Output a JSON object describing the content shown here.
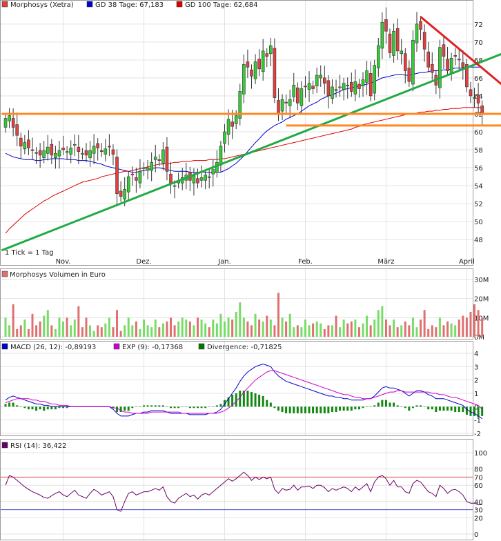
{
  "chart_data": [
    {
      "type": "candlestick",
      "legend": [
        {
          "label": "Morphosys (Xetra)",
          "color": "#d94040"
        },
        {
          "label": "GD 38 Tage: 67,183",
          "color": "#0000cc"
        },
        {
          "label": "GD 100 Tage: 62,684",
          "color": "#dd0000"
        }
      ],
      "y_ticks": [
        "72",
        "70",
        "68",
        "66",
        "64",
        "62",
        "60",
        "58",
        "56",
        "54",
        "52",
        "50",
        "48"
      ],
      "ylim": [
        46.4,
        73.6
      ],
      "x_ticks": [
        "Nov.",
        "Dez.",
        "Jan.",
        "Feb.",
        "März",
        "April"
      ],
      "x_tick_index": [
        15,
        36,
        57,
        78,
        99,
        120
      ],
      "tick_note": "1 Tick = 1 Tag",
      "closes": [
        61.5,
        61.8,
        60.5,
        59.6,
        58.4,
        58.8,
        58.2,
        58.0,
        57.6,
        57.4,
        57.9,
        58.3,
        57.4,
        57.6,
        57.9,
        58.0,
        57.8,
        58.2,
        58.6,
        57.8,
        57.6,
        57.4,
        57.9,
        58.4,
        58.2,
        57.8,
        58.1,
        58.3,
        57.5,
        53.1,
        52.8,
        53.6,
        55.0,
        55.2,
        54.6,
        55.6,
        56.0,
        56.0,
        56.6,
        57.2,
        56.8,
        58.0,
        55.6,
        54.3,
        54.0,
        54.6,
        54.9,
        55.2,
        54.6,
        55.1,
        54.3,
        54.9,
        55.2,
        55.0,
        55.8,
        56.6,
        58.4,
        60.0,
        61.4,
        60.6,
        61.8,
        64.5,
        67.5,
        67.2,
        66.2,
        67.8,
        67.0,
        69.0,
        68.4,
        69.6,
        63.8,
        62.0,
        63.6,
        63.2,
        63.6,
        65.2,
        63.2,
        64.8,
        65.0,
        65.4,
        64.8,
        66.3,
        66.3,
        65.4,
        64.0,
        65.0,
        64.6,
        65.0,
        65.4,
        65.2,
        64.5,
        65.6,
        64.8,
        65.8,
        66.8,
        64.0,
        67.4,
        69.6,
        72.2,
        71.2,
        68.8,
        71.2,
        69.0,
        69.0,
        66.8,
        65.6,
        70.2,
        72.0,
        71.4,
        69.2,
        67.2,
        66.6,
        65.2,
        69.4,
        68.4,
        66.8,
        68.2,
        68.4,
        68.0,
        67.2,
        65.0,
        64.0,
        63.8,
        63.2,
        62.0
      ],
      "gd38": [
        57.6,
        57.4,
        57.2,
        57.1,
        57.0,
        56.9,
        56.9,
        56.9,
        56.8,
        56.8,
        56.9,
        56.9,
        57.0,
        57.0,
        57.0,
        57.0,
        56.9,
        56.9,
        56.9,
        56.8,
        56.8,
        56.8,
        56.7,
        56.6,
        56.5,
        56.4,
        56.2,
        56.1,
        56.0,
        55.9,
        55.8,
        55.7,
        55.6,
        55.5,
        55.5,
        55.6,
        55.7,
        55.8,
        55.9,
        56.0,
        56.0,
        55.9,
        55.8,
        55.7,
        55.6,
        55.6,
        55.6,
        55.6,
        55.5,
        55.5,
        55.5,
        55.5,
        55.5,
        55.5,
        55.5,
        55.5,
        55.5,
        55.7,
        55.9,
        56.2,
        56.5,
        56.9,
        57.3,
        57.8,
        58.3,
        58.8,
        59.2,
        59.7,
        60.1,
        60.4,
        60.7,
        60.9,
        61.1,
        61.4,
        61.6,
        61.8,
        62.0,
        62.3,
        62.6,
        62.9,
        63.1,
        63.3,
        63.6,
        63.8,
        64.0,
        64.1,
        64.3,
        64.5,
        64.7,
        64.8,
        64.9,
        65.0,
        65.1,
        65.2,
        65.3,
        65.4,
        65.6,
        65.8,
        66.0,
        66.1,
        66.2,
        66.3,
        66.4,
        66.4,
        66.3,
        66.3,
        66.4,
        66.5,
        66.6,
        66.6,
        66.7,
        66.8,
        66.8,
        66.8,
        66.9,
        66.9,
        67.0,
        67.1,
        67.1,
        67.1,
        67.2,
        67.2,
        67.2,
        67.2,
        67.2
      ],
      "gd100": [
        48.7,
        49.2,
        49.6,
        50.0,
        50.4,
        50.8,
        51.1,
        51.4,
        51.7,
        52.0,
        52.3,
        52.5,
        52.8,
        53.0,
        53.2,
        53.4,
        53.6,
        53.8,
        54.0,
        54.2,
        54.4,
        54.5,
        54.6,
        54.7,
        54.8,
        55.0,
        55.1,
        55.2,
        55.3,
        55.4,
        55.5,
        55.6,
        55.6,
        55.7,
        55.8,
        55.9,
        56.0,
        56.1,
        56.2,
        56.3,
        56.4,
        56.4,
        56.5,
        56.5,
        56.6,
        56.6,
        56.7,
        56.7,
        56.7,
        56.8,
        56.8,
        56.8,
        56.8,
        56.9,
        56.9,
        56.9,
        57.0,
        57.0,
        57.1,
        57.2,
        57.3,
        57.4,
        57.5,
        57.6,
        57.7,
        57.8,
        57.9,
        58.0,
        58.1,
        58.2,
        58.3,
        58.4,
        58.5,
        58.6,
        58.7,
        58.8,
        58.9,
        59.0,
        59.1,
        59.2,
        59.3,
        59.4,
        59.5,
        59.6,
        59.7,
        59.8,
        59.9,
        60.0,
        60.1,
        60.2,
        60.3,
        60.5,
        60.6,
        60.8,
        60.9,
        61.0,
        61.1,
        61.2,
        61.3,
        61.4,
        61.5,
        61.6,
        61.7,
        61.8,
        61.9,
        62.0,
        62.0,
        62.1,
        62.2,
        62.2,
        62.3,
        62.3,
        62.4,
        62.4,
        62.5,
        62.5,
        62.6,
        62.6,
        62.6,
        62.7,
        62.7,
        62.7,
        62.7,
        62.7,
        62.7
      ]
    },
    {
      "type": "bar",
      "title": "Morphosys Volumen in Euro",
      "y_ticks": [
        "30M",
        "20M",
        "10M",
        "0M"
      ],
      "ylim": [
        0,
        30
      ],
      "values": [
        10,
        6,
        17,
        4,
        6,
        9,
        4,
        12,
        6,
        8,
        11,
        14,
        6,
        4,
        10,
        8,
        10,
        6,
        9,
        16,
        5,
        10,
        6,
        3,
        6,
        5,
        7,
        10,
        5,
        14,
        3,
        6,
        10,
        6,
        8,
        4,
        9,
        6,
        5,
        9,
        5,
        7,
        8,
        10,
        6,
        8,
        10,
        9,
        8,
        6,
        10,
        9,
        7,
        5,
        9,
        7,
        12,
        8,
        10,
        9,
        13,
        18,
        10,
        8,
        6,
        12,
        9,
        8,
        11,
        9,
        6,
        23,
        10,
        8,
        12,
        5,
        6,
        5,
        9,
        6,
        7,
        8,
        7,
        4,
        6,
        6,
        11,
        5,
        9,
        7,
        8,
        9,
        5,
        7,
        11,
        6,
        9,
        14,
        16,
        9,
        6,
        9,
        5,
        6,
        8,
        6,
        10,
        5,
        9,
        14,
        4,
        6,
        5,
        10,
        6,
        8,
        7,
        6,
        9,
        11,
        10,
        13,
        17,
        14,
        10
      ]
    },
    {
      "type": "line",
      "legend": [
        {
          "label": "MACD (26, 12): -0,89193",
          "color": "#0000cc"
        },
        {
          "label": "EXP (9): -0,17368",
          "color": "#cc00cc"
        },
        {
          "label": "Divergence: -0,71825",
          "color": "#007700"
        }
      ],
      "y_ticks": [
        "4",
        "3",
        "2",
        "1",
        "0",
        "-1",
        "-2"
      ],
      "ylim": [
        -2,
        4
      ],
      "macd": [
        0.5,
        0.7,
        0.8,
        0.7,
        0.6,
        0.5,
        0.4,
        0.3,
        0.2,
        0.2,
        0.1,
        0.1,
        0.0,
        0.0,
        0.0,
        0.0,
        0.0,
        0.0,
        0.0,
        0.0,
        0.0,
        0.0,
        0.0,
        0.0,
        0.0,
        0.0,
        0.0,
        0.0,
        -0.2,
        -0.5,
        -0.7,
        -0.7,
        -0.7,
        -0.6,
        -0.5,
        -0.5,
        -0.4,
        -0.4,
        -0.3,
        -0.3,
        -0.3,
        -0.3,
        -0.4,
        -0.5,
        -0.5,
        -0.5,
        -0.5,
        -0.5,
        -0.6,
        -0.6,
        -0.6,
        -0.6,
        -0.6,
        -0.5,
        -0.5,
        -0.4,
        -0.2,
        0.2,
        0.6,
        1.0,
        1.4,
        1.9,
        2.3,
        2.6,
        2.8,
        3.0,
        3.1,
        3.2,
        3.1,
        3.0,
        2.6,
        2.3,
        2.1,
        1.9,
        1.8,
        1.7,
        1.6,
        1.5,
        1.4,
        1.3,
        1.2,
        1.1,
        1.0,
        0.9,
        0.8,
        0.8,
        0.7,
        0.7,
        0.6,
        0.6,
        0.5,
        0.5,
        0.5,
        0.5,
        0.6,
        0.6,
        0.8,
        1.1,
        1.4,
        1.5,
        1.4,
        1.4,
        1.3,
        1.2,
        1.0,
        0.8,
        1.0,
        1.2,
        1.2,
        1.1,
        0.9,
        0.8,
        0.6,
        0.6,
        0.6,
        0.5,
        0.4,
        0.3,
        0.2,
        0.1,
        -0.2,
        -0.4,
        -0.5,
        -0.7,
        -0.9
      ],
      "exp": [
        0.3,
        0.4,
        0.5,
        0.6,
        0.6,
        0.6,
        0.6,
        0.5,
        0.5,
        0.4,
        0.4,
        0.3,
        0.2,
        0.2,
        0.1,
        0.1,
        0.1,
        0.0,
        0.0,
        0.0,
        0.0,
        0.0,
        0.0,
        0.0,
        0.0,
        0.0,
        0.0,
        0.0,
        -0.1,
        -0.1,
        -0.3,
        -0.4,
        -0.4,
        -0.5,
        -0.5,
        -0.5,
        -0.5,
        -0.5,
        -0.4,
        -0.4,
        -0.4,
        -0.4,
        -0.4,
        -0.4,
        -0.4,
        -0.4,
        -0.5,
        -0.5,
        -0.5,
        -0.5,
        -0.5,
        -0.5,
        -0.5,
        -0.5,
        -0.5,
        -0.5,
        -0.4,
        -0.3,
        -0.1,
        0.1,
        0.4,
        0.7,
        1.1,
        1.4,
        1.7,
        2.0,
        2.2,
        2.4,
        2.6,
        2.7,
        2.7,
        2.6,
        2.5,
        2.4,
        2.3,
        2.2,
        2.1,
        2.0,
        1.9,
        1.8,
        1.7,
        1.6,
        1.5,
        1.4,
        1.3,
        1.2,
        1.1,
        1.0,
        0.9,
        0.9,
        0.8,
        0.7,
        0.7,
        0.6,
        0.6,
        0.6,
        0.7,
        0.8,
        0.9,
        1.0,
        1.1,
        1.1,
        1.2,
        1.2,
        1.1,
        1.1,
        1.1,
        1.1,
        1.1,
        1.1,
        1.1,
        1.0,
        1.0,
        0.9,
        0.9,
        0.8,
        0.7,
        0.7,
        0.6,
        0.5,
        0.4,
        0.3,
        0.2,
        0.1,
        -0.2
      ],
      "divergence": [
        0.2,
        0.3,
        0.3,
        0.1,
        0.0,
        -0.1,
        -0.2,
        -0.2,
        -0.3,
        -0.2,
        -0.3,
        -0.2,
        -0.2,
        -0.2,
        -0.1,
        -0.1,
        -0.1,
        0.0,
        0.0,
        0.0,
        0.0,
        0.0,
        0.0,
        0.0,
        0.0,
        0.0,
        0.0,
        0.0,
        -0.1,
        -0.4,
        -0.4,
        -0.3,
        -0.3,
        -0.1,
        0.0,
        0.0,
        0.1,
        0.1,
        0.1,
        0.1,
        0.1,
        0.1,
        0.0,
        -0.1,
        -0.1,
        -0.1,
        0.0,
        0.0,
        -0.1,
        -0.1,
        -0.1,
        -0.1,
        -0.1,
        0.0,
        0.0,
        0.1,
        0.2,
        0.5,
        0.7,
        0.9,
        1.0,
        1.2,
        1.2,
        1.2,
        1.1,
        1.0,
        0.9,
        0.8,
        0.5,
        0.3,
        -0.1,
        -0.3,
        -0.4,
        -0.5,
        -0.5,
        -0.5,
        -0.5,
        -0.5,
        -0.5,
        -0.5,
        -0.5,
        -0.5,
        -0.5,
        -0.5,
        -0.5,
        -0.4,
        -0.4,
        -0.3,
        -0.3,
        -0.3,
        -0.3,
        -0.2,
        -0.2,
        -0.1,
        0.0,
        0.0,
        0.1,
        0.3,
        0.5,
        0.5,
        0.3,
        0.3,
        0.1,
        0.0,
        -0.1,
        -0.3,
        -0.1,
        0.1,
        0.1,
        0.0,
        -0.2,
        -0.2,
        -0.4,
        -0.3,
        -0.3,
        -0.3,
        -0.3,
        -0.4,
        -0.4,
        -0.4,
        -0.6,
        -0.7,
        -0.7,
        -0.8,
        -0.7
      ]
    },
    {
      "type": "line",
      "legend": [
        {
          "label": "RSI (14): 36,422",
          "color": "#660066"
        }
      ],
      "y_ticks": [
        "100",
        "80",
        "70",
        "60",
        "40",
        "30",
        "20",
        "0"
      ],
      "ylim": [
        0,
        100
      ],
      "levels": [
        70,
        30
      ],
      "values": [
        60,
        72,
        70,
        66,
        62,
        58,
        55,
        52,
        50,
        48,
        45,
        44,
        47,
        50,
        52,
        48,
        46,
        50,
        54,
        48,
        46,
        44,
        50,
        55,
        52,
        48,
        50,
        52,
        46,
        30,
        28,
        40,
        50,
        52,
        48,
        50,
        52,
        52,
        54,
        56,
        54,
        58,
        46,
        40,
        38,
        44,
        47,
        50,
        46,
        48,
        43,
        48,
        50,
        48,
        52,
        56,
        60,
        64,
        68,
        65,
        68,
        72,
        76,
        72,
        66,
        70,
        67,
        70,
        68,
        70,
        55,
        50,
        56,
        54,
        55,
        60,
        54,
        58,
        58,
        59,
        56,
        60,
        60,
        57,
        52,
        56,
        54,
        56,
        58,
        56,
        52,
        58,
        54,
        58,
        62,
        52,
        64,
        70,
        72,
        68,
        60,
        66,
        58,
        58,
        52,
        50,
        62,
        66,
        64,
        58,
        52,
        50,
        46,
        60,
        56,
        50,
        54,
        55,
        52,
        48,
        40,
        38,
        38,
        36,
        36
      ]
    },
    {
      "type": "annotations",
      "trendlines": [
        {
          "name": "uptrend",
          "color": "#22aa44",
          "from": {
            "x": -1,
            "y": 46.8
          },
          "to": {
            "x": 131,
            "y": 69.0
          }
        },
        {
          "name": "downtrend",
          "color": "#e02020",
          "from": {
            "x": 108,
            "y": 72.8
          },
          "to": {
            "x": 131,
            "y": 64.6
          }
        },
        {
          "name": "support-1",
          "color": "#ff8822",
          "from": {
            "x": -1,
            "y": 62.0
          },
          "to": {
            "x": 131,
            "y": 62.0
          }
        },
        {
          "name": "support-2",
          "color": "#ff8822",
          "from": {
            "x": 73,
            "y": 60.7
          },
          "to": {
            "x": 131,
            "y": 60.7
          }
        }
      ]
    }
  ]
}
